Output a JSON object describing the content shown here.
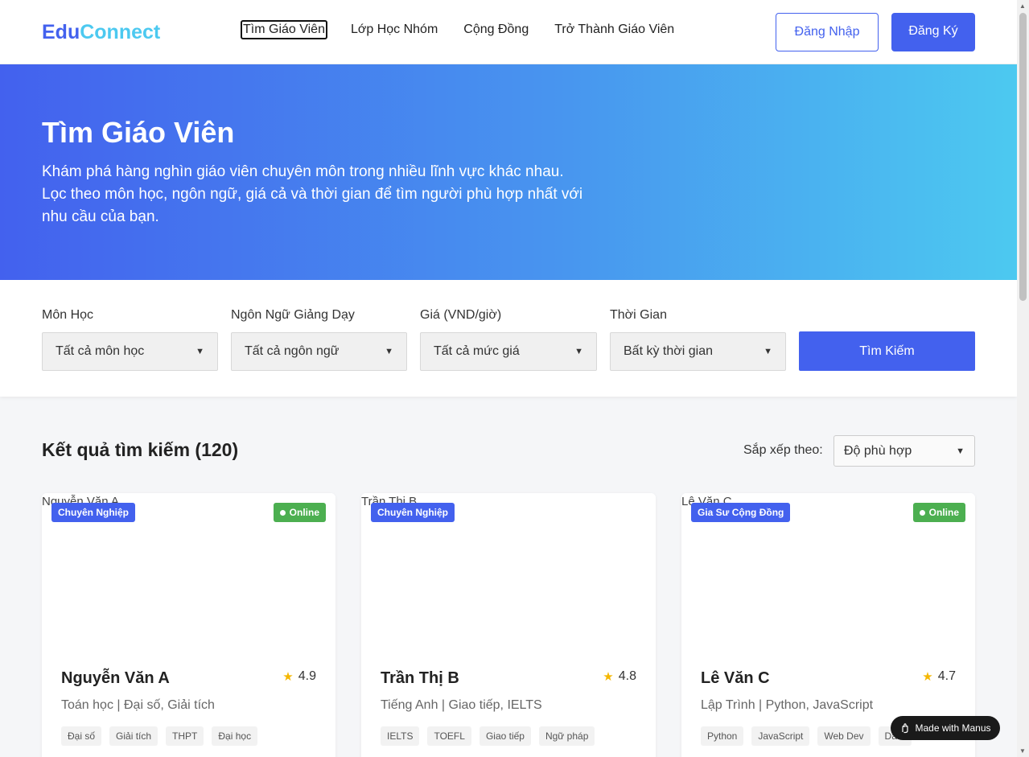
{
  "nav": {
    "logo_part1": "Edu",
    "logo_part2": "Connect",
    "links": [
      "Tìm Giáo Viên",
      "Lớp Học Nhóm",
      "Cộng Đồng",
      "Trở Thành Giáo Viên"
    ],
    "login": "Đăng Nhập",
    "register": "Đăng Ký"
  },
  "hero": {
    "title": "Tìm Giáo Viên",
    "description": "Khám phá hàng nghìn giáo viên chuyên môn trong nhiều lĩnh vực khác nhau. Lọc theo môn học, ngôn ngữ, giá cả và thời gian để tìm người phù hợp nhất với nhu cầu của bạn."
  },
  "filters": {
    "subject": {
      "label": "Môn Học",
      "value": "Tất cả môn học"
    },
    "language": {
      "label": "Ngôn Ngữ Giảng Dạy",
      "value": "Tất cả ngôn ngữ"
    },
    "price": {
      "label": "Giá (VND/giờ)",
      "value": "Tất cả mức giá"
    },
    "time": {
      "label": "Thời Gian",
      "value": "Bất kỳ thời gian"
    },
    "search_button": "Tìm Kiếm"
  },
  "results": {
    "title": "Kết quả tìm kiếm (120)",
    "sort_label": "Sắp xếp theo:",
    "sort_value": "Độ phù hợp"
  },
  "teachers": [
    {
      "photo_alt": "Nguyễn Văn A",
      "type": "Chuyên Nghiệp",
      "online": "Online",
      "name": "Nguyễn Văn A",
      "rating": "4.9",
      "subject": "Toán học | Đại số, Giải tích",
      "tags": [
        "Đại số",
        "Giải tích",
        "THPT",
        "Đại học"
      ]
    },
    {
      "photo_alt": "Trần Thị B",
      "type": "Chuyên Nghiệp",
      "online": "",
      "name": "Trần Thị B",
      "rating": "4.8",
      "subject": "Tiếng Anh | Giao tiếp, IELTS",
      "tags": [
        "IELTS",
        "TOEFL",
        "Giao tiếp",
        "Ngữ pháp"
      ]
    },
    {
      "photo_alt": "Lê Văn C",
      "type": "Gia Sư Cộng Đồng",
      "online": "Online",
      "name": "Lê Văn C",
      "rating": "4.7",
      "subject": "Lập Trình | Python, JavaScript",
      "tags": [
        "Python",
        "JavaScript",
        "Web Dev",
        "Data"
      ]
    }
  ],
  "manus_badge": "Made with Manus",
  "colors": {
    "primary": "#4361ee",
    "accent": "#4cc9f0",
    "online": "#4caf50",
    "star": "#f5b700"
  }
}
